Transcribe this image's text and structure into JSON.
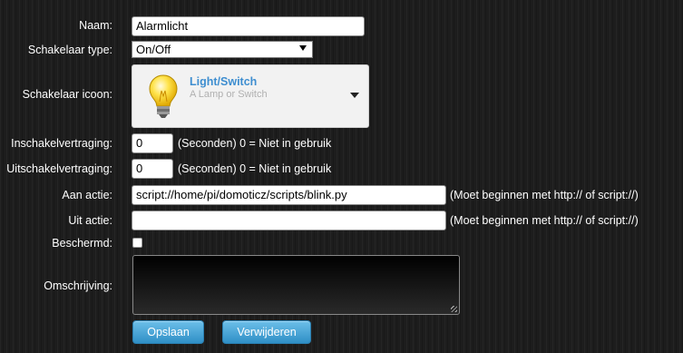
{
  "form": {
    "naam": {
      "label": "Naam:",
      "value": "Alarmlicht"
    },
    "schakelaar_type": {
      "label": "Schakelaar type:",
      "value": "On/Off"
    },
    "schakelaar_icoon": {
      "label": "Schakelaar icoon:",
      "title": "Light/Switch",
      "description": "A Lamp or Switch",
      "icon": "light-bulb-icon"
    },
    "inschakelvertraging": {
      "label": "Inschakelvertraging:",
      "value": "0",
      "hint": "(Seconden) 0 = Niet in gebruik"
    },
    "uitschakelvertraging": {
      "label": "Uitschakelvertraging:",
      "value": "0",
      "hint": "(Seconden) 0 = Niet in gebruik"
    },
    "aan_actie": {
      "label": "Aan actie:",
      "value": "script://home/pi/domoticz/scripts/blink.py",
      "hint": "(Moet beginnen met http:// of script://)"
    },
    "uit_actie": {
      "label": "Uit actie:",
      "value": "",
      "hint": "(Moet beginnen met http:// of script://)"
    },
    "beschermd": {
      "label": "Beschermd:",
      "checked": false
    },
    "omschrijving": {
      "label": "Omschrijving:",
      "value": ""
    }
  },
  "buttons": {
    "save": "Opslaan",
    "delete": "Verwijderen"
  },
  "colors": {
    "accent": "#3e8ed0",
    "button": "#4aa7dc"
  }
}
